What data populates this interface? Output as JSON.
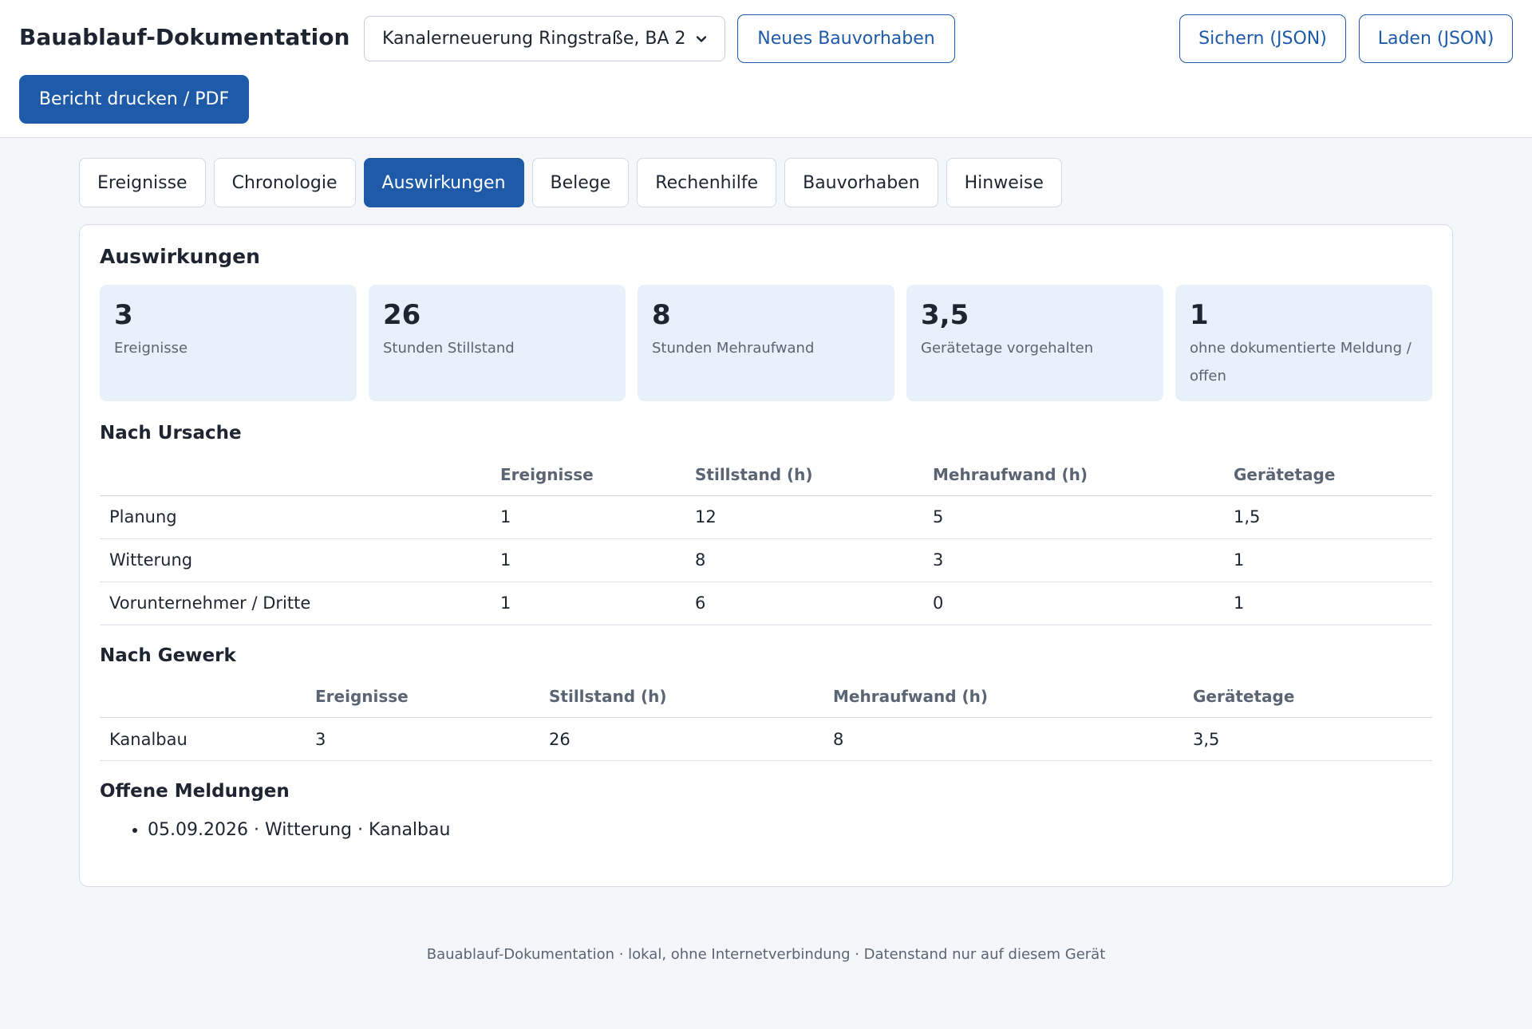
{
  "header": {
    "title": "Bauablauf-Dokumentation",
    "project_select": "Kanalerneuerung Ringstraße, BA 2",
    "new_project_label": "Neues Bauvorhaben",
    "save_label": "Sichern (JSON)",
    "load_label": "Laden (JSON)",
    "print_label": "Bericht drucken / PDF"
  },
  "tabs": [
    {
      "label": "Ereignisse",
      "active": false
    },
    {
      "label": "Chronologie",
      "active": false
    },
    {
      "label": "Auswirkungen",
      "active": true
    },
    {
      "label": "Belege",
      "active": false
    },
    {
      "label": "Rechenhilfe",
      "active": false
    },
    {
      "label": "Bauvorhaben",
      "active": false
    },
    {
      "label": "Hinweise",
      "active": false
    }
  ],
  "panel": {
    "title": "Auswirkungen",
    "stats": [
      {
        "value": "3",
        "label": "Ereignisse"
      },
      {
        "value": "26",
        "label": "Stunden Stillstand"
      },
      {
        "value": "8",
        "label": "Stunden Mehraufwand"
      },
      {
        "value": "3,5",
        "label": "Gerätetage vorgehalten"
      },
      {
        "value": "1",
        "label": "ohne dokumentierte Meldung / offen"
      }
    ],
    "by_cause": {
      "title": "Nach Ursache",
      "headers": [
        "",
        "Ereignisse",
        "Stillstand (h)",
        "Mehraufwand (h)",
        "Gerätetage"
      ],
      "rows": [
        [
          "Planung",
          "1",
          "12",
          "5",
          "1,5"
        ],
        [
          "Witterung",
          "1",
          "8",
          "3",
          "1"
        ],
        [
          "Vorunternehmer / Dritte",
          "1",
          "6",
          "0",
          "1"
        ]
      ]
    },
    "by_trade": {
      "title": "Nach Gewerk",
      "headers": [
        "",
        "Ereignisse",
        "Stillstand (h)",
        "Mehraufwand (h)",
        "Gerätetage"
      ],
      "rows": [
        [
          "Kanalbau",
          "3",
          "26",
          "8",
          "3,5"
        ]
      ]
    },
    "open_reports": {
      "title": "Offene Meldungen",
      "items": [
        "05.09.2026 · Witterung · Kanalbau"
      ]
    }
  },
  "footer": "Bauablauf-Dokumentation · lokal, ohne Internetverbindung · Datenstand nur auf diesem Gerät"
}
